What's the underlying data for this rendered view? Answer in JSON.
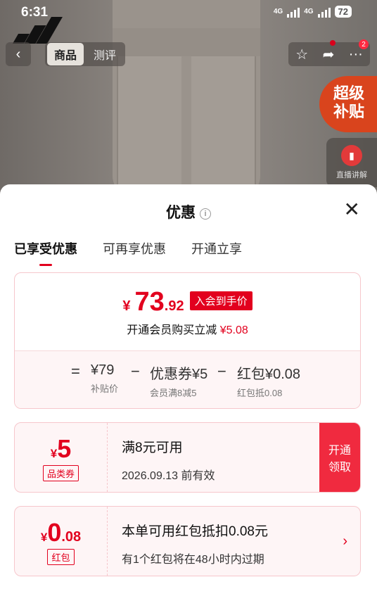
{
  "status": {
    "time": "6:31",
    "net1": "4G",
    "net2": "4G",
    "battery": "72"
  },
  "header": {
    "back_label": "‹",
    "tabs": [
      {
        "label": "商品",
        "active": true
      },
      {
        "label": "测评",
        "active": false
      }
    ],
    "cart_badge": "2",
    "super_badge": "超级补贴",
    "super_line1": "超级",
    "super_line2": "补贴",
    "live_label": "直播讲解"
  },
  "sheet": {
    "title": "优惠",
    "info_icon": "i",
    "close_icon": "✕",
    "tabs": [
      {
        "label": "已享受优惠",
        "active": true
      },
      {
        "label": "可再享优惠",
        "active": false
      },
      {
        "label": "开通立享",
        "active": false
      }
    ]
  },
  "price": {
    "currency": "¥",
    "integer": "73",
    "decimal": ".92",
    "tag": "入会到手价",
    "member_text": "开通会员购买立减",
    "member_discount": "¥5.08"
  },
  "calc": {
    "equals": "=",
    "item1_main": "¥79",
    "item1_sub": "补贴价",
    "minus1": "−",
    "item2_main": "优惠券¥5",
    "item2_sub": "会员满8减5",
    "minus2": "−",
    "item3_main": "红包¥0.08",
    "item3_sub": "红包抵0.08"
  },
  "coupons": [
    {
      "currency": "¥",
      "amount": "5",
      "decimal": "",
      "type": "品类券",
      "title": "满8元可用",
      "desc": "2026.09.13 前有效",
      "action_line1": "开通",
      "action_line2": "领取"
    },
    {
      "currency": "¥",
      "amount": "0",
      "decimal": ".08",
      "type": "红包",
      "title": "本单可用红包抵扣0.08元",
      "desc": "有1个红包将在48小时内过期",
      "chevron": "›"
    }
  ],
  "colors": {
    "accent": "#e2001e",
    "coupon_bg": "#fef5f6",
    "super_badge": "#d9441d"
  }
}
